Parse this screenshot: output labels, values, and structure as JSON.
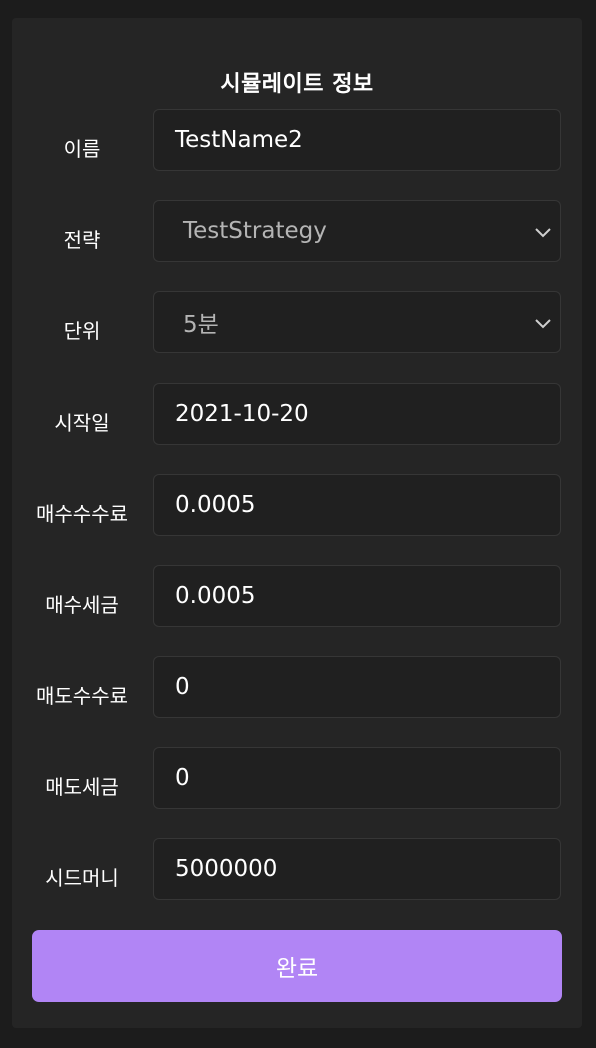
{
  "form": {
    "title": "시뮬레이트 정보",
    "fields": [
      {
        "label": "이름",
        "value": "TestName2",
        "type": "input"
      },
      {
        "label": "전략",
        "value": "TestStrategy",
        "type": "select"
      },
      {
        "label": "단위",
        "value": "5분",
        "type": "select"
      },
      {
        "label": "시작일",
        "value": "2021-10-20",
        "type": "input"
      },
      {
        "label": "매수수수료",
        "value": "0.0005",
        "type": "input"
      },
      {
        "label": "매수세금",
        "value": "0.0005",
        "type": "input"
      },
      {
        "label": "매도수수료",
        "value": "0",
        "type": "input"
      },
      {
        "label": "매도세금",
        "value": "0",
        "type": "input"
      },
      {
        "label": "시드머니",
        "value": "5000000",
        "type": "input"
      }
    ],
    "submit_label": "완료"
  },
  "colors": {
    "background": "#1c1c1c",
    "panel": "#252525",
    "field": "#202020",
    "accent": "#b185f5"
  }
}
